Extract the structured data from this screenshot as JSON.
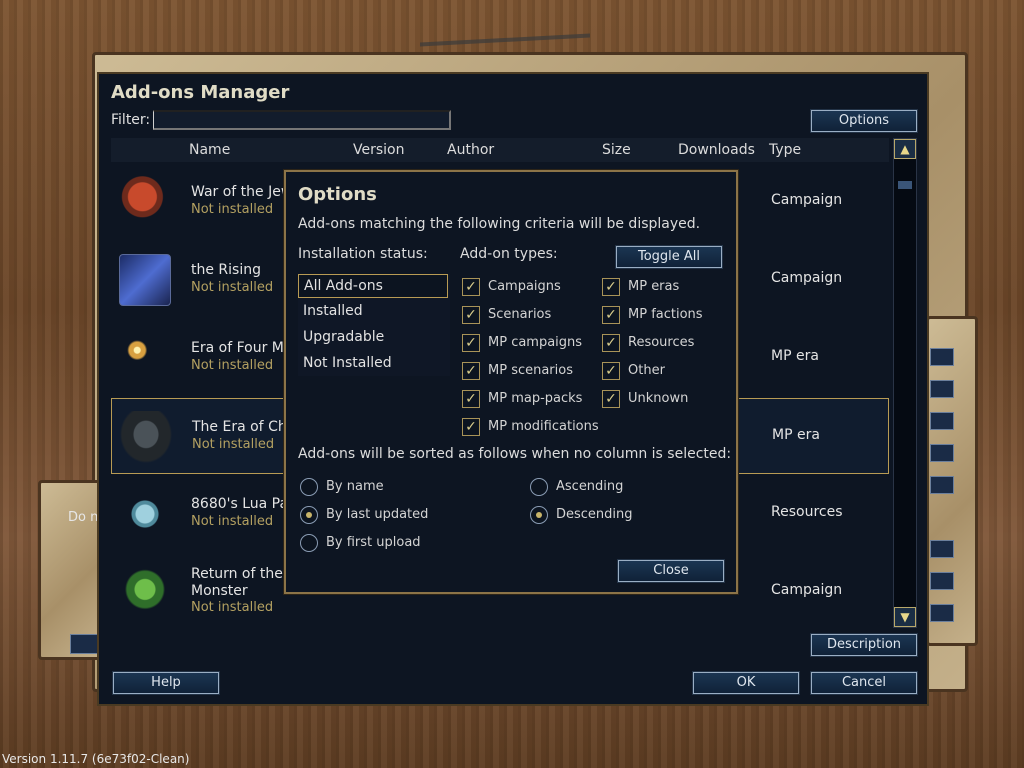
{
  "version_text": "Version 1.11.7 (6e73f02-Clean)",
  "background": {
    "left_text": "Do n"
  },
  "main": {
    "title": "Add-ons Manager",
    "filter_label": "Filter:",
    "filter_value": "",
    "options_button": "Options",
    "columns": [
      "Name",
      "Version",
      "Author",
      "Size",
      "Downloads",
      "Type"
    ],
    "rows": [
      {
        "name": "War of the Jew",
        "status": "Not installed",
        "type": "Campaign",
        "icon": "warrior-icon",
        "color": "#7a2a1e"
      },
      {
        "name": "the Rising",
        "status": "Not installed",
        "type": "Campaign",
        "icon": "lightning-icon",
        "color": "#3b54a8"
      },
      {
        "name": "Era of Four M",
        "status": "Not installed",
        "type": "MP era",
        "icon": "spark-icon",
        "color": "#c89a3a"
      },
      {
        "name": "The Era of Ch",
        "status": "Not installed",
        "type": "MP era",
        "icon": "dark-knight-icon",
        "color": "#2c3034"
      },
      {
        "name": "8680's Lua Pa",
        "status": "Not installed",
        "type": "Resources",
        "icon": "book-icon",
        "color": "#6fa6b8"
      },
      {
        "name_line1": "Return of the",
        "name_line2": "Monster",
        "status": "Not installed",
        "type": "Campaign",
        "icon": "dragon-warrior-icon",
        "color": "#3c8a3a"
      }
    ],
    "selected_row": 3,
    "description_button": "Description",
    "help_button": "Help",
    "ok_button": "OK",
    "cancel_button": "Cancel"
  },
  "options": {
    "title": "Options",
    "description": "Add-ons matching the following criteria will be displayed.",
    "installation_label": "Installation status:",
    "status_items": [
      "All Add-ons",
      "Installed",
      "Upgradable",
      "Not Installed"
    ],
    "selected_status": 0,
    "types_label": "Add-on types:",
    "toggle_all": "Toggle All",
    "types_col1": [
      "Campaigns",
      "Scenarios",
      "MP campaigns",
      "MP scenarios",
      "MP map-packs",
      "MP modifications"
    ],
    "types_col2": [
      "MP eras",
      "MP factions",
      "Resources",
      "Other",
      "Unknown"
    ],
    "sort_label": "Add-ons will be sorted as follows when no column is selected:",
    "sort_by": [
      "By name",
      "By last updated",
      "By first upload"
    ],
    "sort_by_selected": 1,
    "order": [
      "Ascending",
      "Descending"
    ],
    "order_selected": 1,
    "close_button": "Close"
  },
  "colors": {
    "accent_gold": "#b89b54",
    "status_gold": "#b3a061",
    "panel": "#0d1522"
  }
}
